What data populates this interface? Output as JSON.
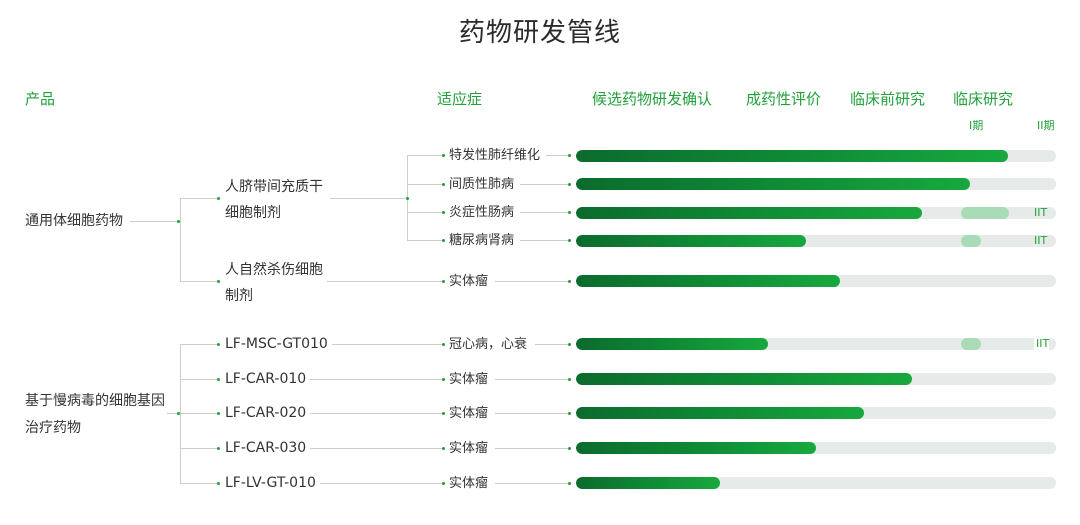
{
  "title": "药物研发管线",
  "headers": {
    "product": "产品",
    "indication": "适应症",
    "stages": [
      "候选药物研发确认",
      "成药性评价",
      "临床前研究",
      "临床研究"
    ],
    "phases": [
      "I期",
      "II期"
    ]
  },
  "categories": [
    {
      "name": "通用体细胞药物"
    },
    {
      "name_lines": [
        "基于慢病毒的细胞基因",
        "治疗药物"
      ]
    }
  ],
  "products": [
    {
      "name_lines": [
        "人脐带间充质干",
        "细胞制剂"
      ]
    },
    {
      "name_lines": [
        "人自然杀伤细胞",
        "制剂"
      ]
    },
    {
      "name": "LF-MSC-GT010"
    },
    {
      "name": "LF-CAR-010"
    },
    {
      "name": "LF-CAR-020"
    },
    {
      "name": "LF-CAR-030"
    },
    {
      "name": "LF-LV-GT-010"
    }
  ],
  "pipeline": [
    {
      "indication": "特发性肺纤维化",
      "progress": 0.9,
      "iit": ""
    },
    {
      "indication": "间质性肺病",
      "progress": 0.82,
      "iit": ""
    },
    {
      "indication": "炎症性肠病",
      "progress": 0.72,
      "iit": "IIT",
      "clinical_bar": "I-II"
    },
    {
      "indication": "糖尿病肾病",
      "progress": 0.48,
      "iit": "IIT",
      "clinical_bar": "I"
    },
    {
      "indication": "实体瘤",
      "progress": 0.55,
      "iit": ""
    },
    {
      "indication": "冠心病，心衰",
      "progress": 0.4,
      "iit": "IIT",
      "clinical_bar": "I"
    },
    {
      "indication": "实体瘤",
      "progress": 0.7,
      "iit": ""
    },
    {
      "indication": "实体瘤",
      "progress": 0.6,
      "iit": ""
    },
    {
      "indication": "实体瘤",
      "progress": 0.5,
      "iit": ""
    },
    {
      "indication": "实体瘤",
      "progress": 0.3,
      "iit": ""
    }
  ]
}
